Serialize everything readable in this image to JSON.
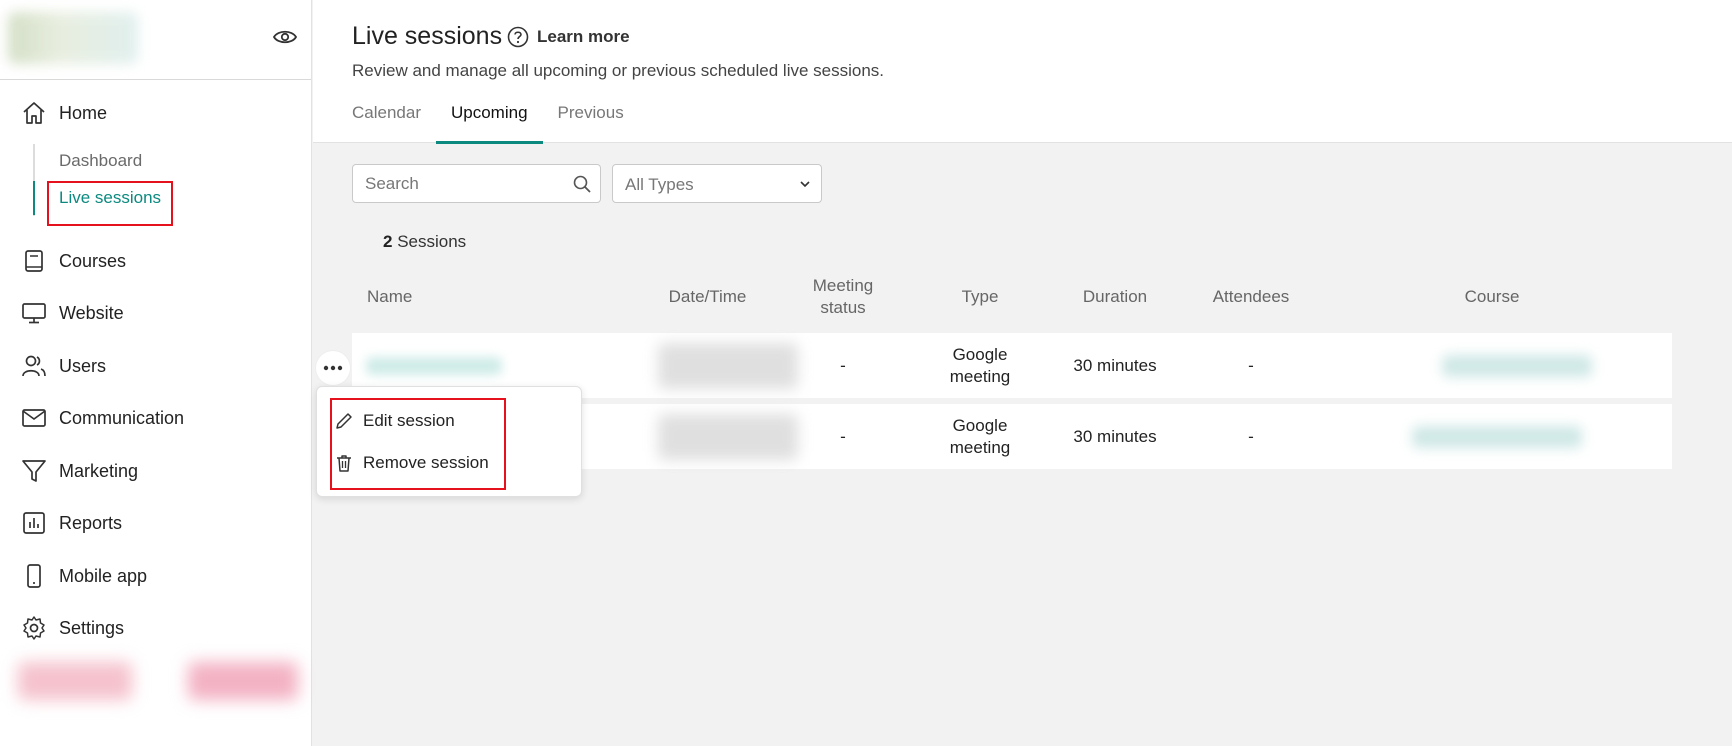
{
  "sidebar": {
    "eye_icon": "eye-icon",
    "items": [
      {
        "label": "Home",
        "icon": "home-icon"
      },
      {
        "label": "Courses",
        "icon": "book-icon"
      },
      {
        "label": "Website",
        "icon": "monitor-icon"
      },
      {
        "label": "Users",
        "icon": "users-icon"
      },
      {
        "label": "Communication",
        "icon": "mail-icon"
      },
      {
        "label": "Marketing",
        "icon": "funnel-icon"
      },
      {
        "label": "Reports",
        "icon": "bar-chart-icon"
      },
      {
        "label": "Mobile app",
        "icon": "phone-icon"
      },
      {
        "label": "Settings",
        "icon": "gear-icon"
      }
    ],
    "home_sub": [
      {
        "label": "Dashboard",
        "active": false
      },
      {
        "label": "Live sessions",
        "active": true
      }
    ]
  },
  "header": {
    "title": "Live sessions",
    "learn_more": "Learn more",
    "subtitle": "Review and manage all upcoming or previous scheduled live sessions.",
    "tabs": [
      {
        "label": "Calendar",
        "active": false
      },
      {
        "label": "Upcoming",
        "active": true
      },
      {
        "label": "Previous",
        "active": false
      }
    ]
  },
  "filters": {
    "search_placeholder": "Search",
    "type_select": "All Types"
  },
  "summary": {
    "count": "2",
    "count_label": "Sessions"
  },
  "table": {
    "columns": [
      "Name",
      "Date/Time",
      "Meeting status",
      "Type",
      "Duration",
      "Attendees",
      "Course"
    ],
    "rows": [
      {
        "meeting_status": "-",
        "type": "Google meeting",
        "duration": "30 minutes",
        "attendees": "-"
      },
      {
        "meeting_status": "-",
        "type": "Google meeting",
        "duration": "30 minutes",
        "attendees": "-"
      }
    ]
  },
  "context_menu": {
    "items": [
      {
        "label": "Edit session",
        "icon": "pencil-icon"
      },
      {
        "label": "Remove session",
        "icon": "trash-icon"
      }
    ]
  },
  "colors": {
    "accent": "#0c8a7f",
    "highlight": "#e5121d"
  }
}
